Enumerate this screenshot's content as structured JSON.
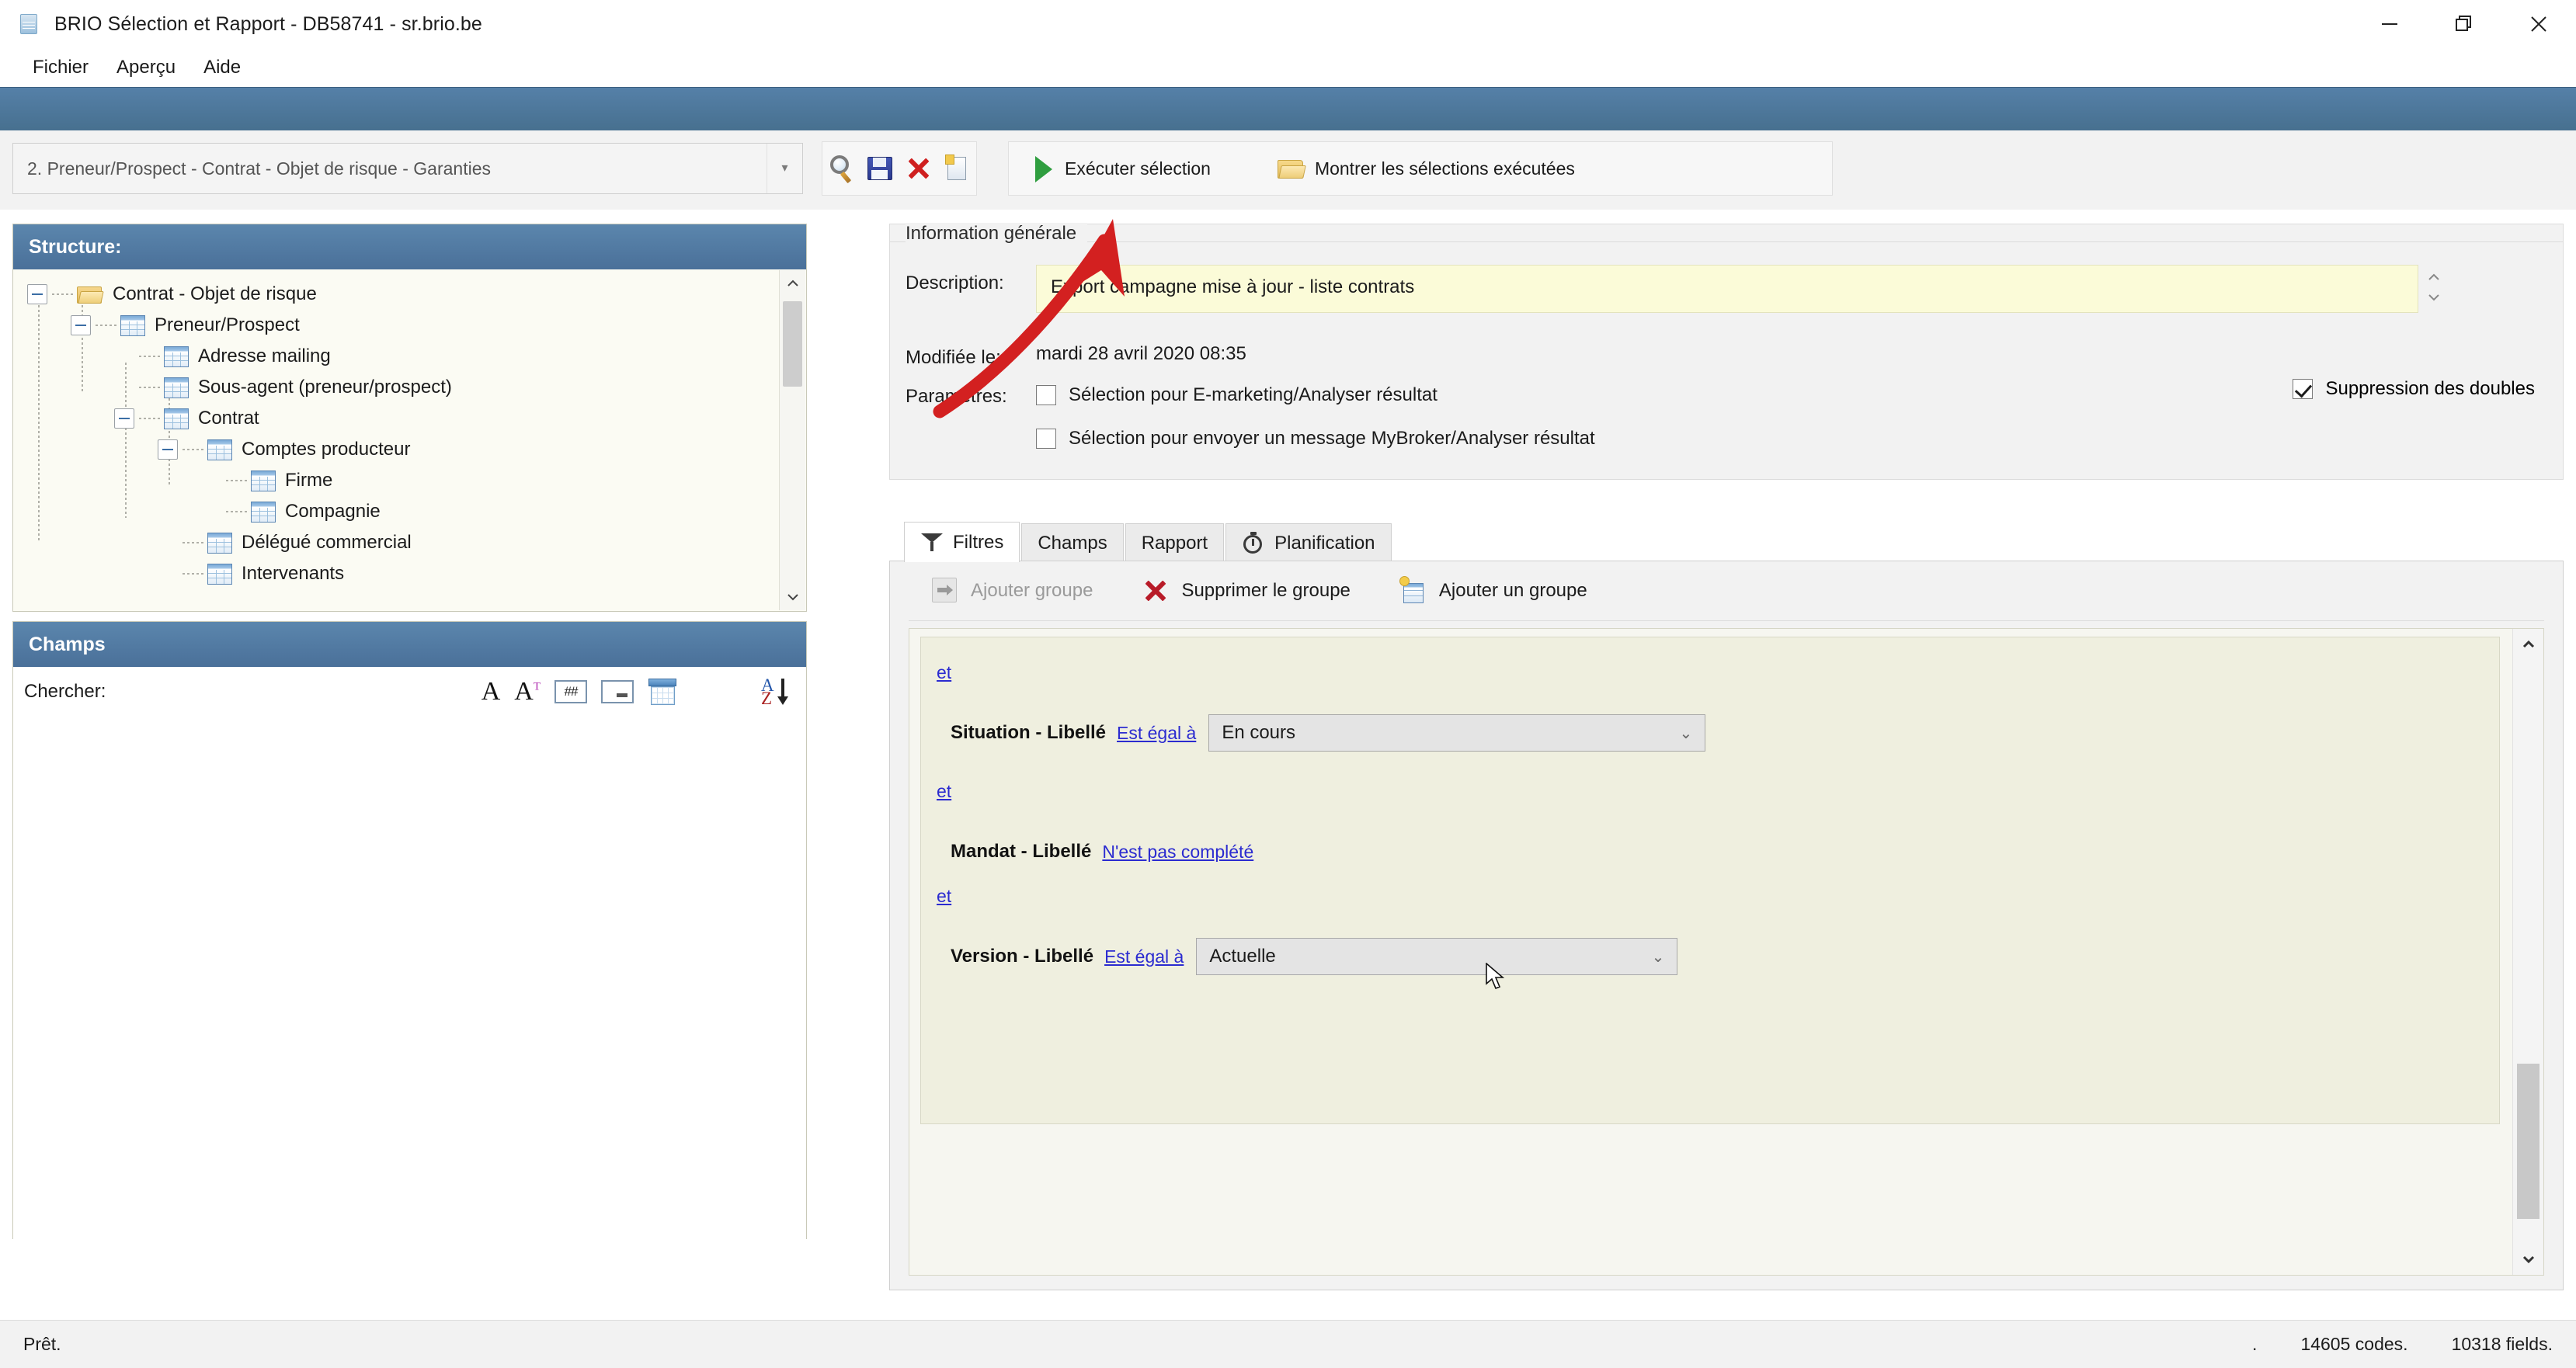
{
  "window": {
    "title": "BRIO Sélection et Rapport - DB58741 - sr.brio.be",
    "app_icon": "brio-app-icon",
    "minimize": "minimize-icon",
    "restore": "restore-icon",
    "close": "close-icon"
  },
  "menubar": {
    "items": [
      {
        "label": "Fichier"
      },
      {
        "label": "Aperçu"
      },
      {
        "label": "Aide"
      }
    ]
  },
  "toolbar": {
    "selection_combo": {
      "value": "2. Preneur/Prospect - Contrat - Objet de risque - Garanties",
      "chevron": "▾"
    },
    "icon_buttons": [
      {
        "name": "search-icon"
      },
      {
        "name": "save-icon"
      },
      {
        "name": "delete-icon"
      },
      {
        "name": "new-document-icon"
      }
    ],
    "run_selection": {
      "label": "Exécuter sélection",
      "icon": "play-icon"
    },
    "show_executed": {
      "label": "Montrer les sélections exécutées",
      "icon": "open-folder-icon"
    }
  },
  "structure_panel": {
    "header": "Structure:",
    "tree": [
      {
        "label": "Contrat - Objet de risque",
        "depth": 0,
        "icon": "folder-icon",
        "expander": "collapse"
      },
      {
        "label": "Preneur/Prospect",
        "depth": 1,
        "icon": "table-icon",
        "expander": "collapse"
      },
      {
        "label": "Adresse mailing",
        "depth": 2,
        "icon": "table-icon",
        "expander": "none"
      },
      {
        "label": "Sous-agent (preneur/prospect)",
        "depth": 2,
        "icon": "table-icon",
        "expander": "none"
      },
      {
        "label": "Contrat",
        "depth": 2,
        "icon": "table-icon",
        "expander": "collapse"
      },
      {
        "label": "Comptes producteur",
        "depth": 3,
        "icon": "table-icon",
        "expander": "collapse"
      },
      {
        "label": "Firme",
        "depth": 4,
        "icon": "table-icon",
        "expander": "none"
      },
      {
        "label": "Compagnie",
        "depth": 4,
        "icon": "table-icon",
        "expander": "none"
      },
      {
        "label": "Délégué commercial",
        "depth": 3,
        "icon": "table-icon",
        "expander": "none"
      },
      {
        "label": "Intervenants",
        "depth": 3,
        "icon": "table-icon",
        "expander": "none"
      }
    ],
    "scroll_up": "scroll-up-icon",
    "scroll_down": "scroll-down-icon"
  },
  "champs_panel": {
    "header": "Champs",
    "search_label": "Chercher:",
    "search_value": "",
    "search_placeholder": "",
    "filter_icons": [
      {
        "name": "text-type-icon",
        "glyph": "A"
      },
      {
        "name": "text-translated-icon",
        "glyph": "A"
      },
      {
        "name": "number-type-icon",
        "glyph": "##"
      },
      {
        "name": "boolean-type-icon",
        "glyph": ""
      },
      {
        "name": "date-type-icon",
        "glyph": ""
      }
    ],
    "sort_icon": "sort-az-icon"
  },
  "info": {
    "group_title": "Information générale",
    "description_label": "Description:",
    "description_value": "Export campagne mise à jour - liste contrats",
    "modified_label": "Modifiée le:",
    "modified_value": "mardi 28 avril 2020 08:35",
    "parameters_label": "Paramètres:",
    "checkboxes": [
      {
        "label": "Sélection pour E-marketing/Analyser résultat",
        "checked": false
      },
      {
        "label": "Sélection pour envoyer un message MyBroker/Analyser résultat",
        "checked": false
      }
    ],
    "dedupe": {
      "label": "Suppression des doubles",
      "checked": true
    },
    "spin_up": "spinner-up-icon",
    "spin_down": "spinner-down-icon"
  },
  "tabs": [
    {
      "label": "Filtres",
      "icon": "funnel-icon",
      "active": true
    },
    {
      "label": "Champs",
      "icon": "",
      "active": false
    },
    {
      "label": "Rapport",
      "icon": "",
      "active": false
    },
    {
      "label": "Planification",
      "icon": "clock-icon",
      "active": false
    }
  ],
  "filters": {
    "toolbar": [
      {
        "label": "Ajouter groupe",
        "icon": "add-group-arrow-icon",
        "disabled": true
      },
      {
        "label": "Supprimer le groupe",
        "icon": "delete-group-icon",
        "disabled": false
      },
      {
        "label": "Ajouter un groupe",
        "icon": "new-group-icon",
        "disabled": false
      }
    ],
    "conditions": [
      {
        "operator": "et",
        "field": "Situation - Libellé",
        "comparator": "Est égal à",
        "value": "En cours",
        "has_select": true
      },
      {
        "operator": "et",
        "field": "Mandat - Libellé",
        "comparator": "N'est pas complété",
        "value": "",
        "has_select": false
      },
      {
        "operator": "et",
        "field": "Version - Libellé",
        "comparator": "Est égal à",
        "value": "Actuelle",
        "has_select": true
      }
    ],
    "scroll_up": "scroll-up-icon",
    "scroll_down": "scroll-down-icon"
  },
  "statusbar": {
    "left": "Prêt.",
    "dot": ".",
    "codes": "14605 codes.",
    "fields": "10318 fields."
  },
  "annotation": {
    "arrow_color": "#d32020"
  },
  "colors": {
    "accent": "#4a7299",
    "panel_header": "#4f7aa5",
    "link": "#2b2bd0",
    "description_bg": "#fbfbd8",
    "filter_bg": "#efefdf"
  }
}
